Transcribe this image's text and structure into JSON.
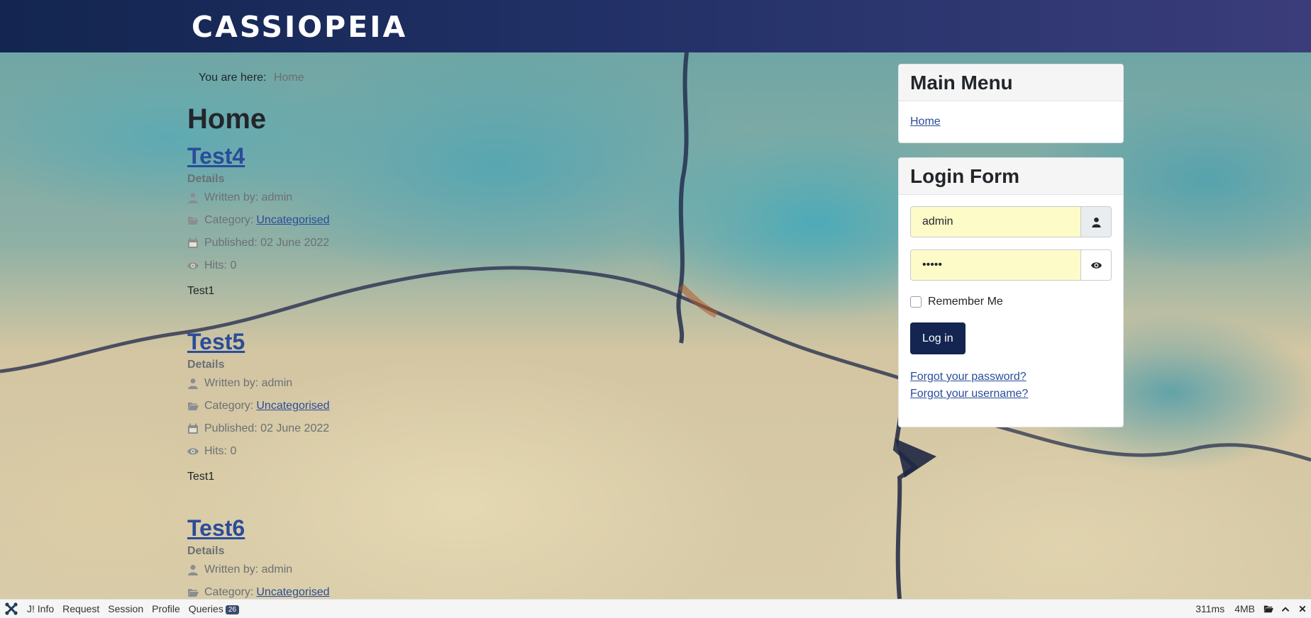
{
  "header": {
    "brand": "CASSIOPEIA",
    "gradient_start": "#132550",
    "gradient_end": "#3a3d7a"
  },
  "breadcrumb": {
    "prefix": "You are here:",
    "current": "Home"
  },
  "main": {
    "page_title": "Home",
    "articles": [
      {
        "title": "Test4",
        "details_label": "Details",
        "author": "Written by: admin",
        "category_prefix": "Category:",
        "category": "Uncategorised",
        "published": "Published: 02 June 2022",
        "hits": "Hits: 0",
        "body": "Test1"
      },
      {
        "title": "Test5",
        "details_label": "Details",
        "author": "Written by: admin",
        "category_prefix": "Category:",
        "category": "Uncategorised",
        "published": "Published: 02 June 2022",
        "hits": "Hits: 0",
        "body": "Test1"
      },
      {
        "title": "Test6",
        "details_label": "Details",
        "author": "Written by: admin",
        "category_prefix": "Category:",
        "category": "Uncategorised"
      }
    ]
  },
  "main_menu": {
    "title": "Main Menu",
    "items": [
      "Home"
    ]
  },
  "login_form": {
    "title": "Login Form",
    "username_value": "admin",
    "password_value": "•••••",
    "remember_label": "Remember Me",
    "login_button": "Log in",
    "forgot_password": "Forgot your password?",
    "forgot_username": "Forgot your username?",
    "username_icon": "user-icon",
    "password_icon": "eye-icon",
    "field_color": "#fdfbc8",
    "button_color": "#132550"
  },
  "debugbar": {
    "tabs": [
      "J! Info",
      "Request",
      "Session",
      "Profile",
      "Queries"
    ],
    "queries_count": "26",
    "time": "311ms",
    "memory": "4MB",
    "icons": [
      "joomla-icon",
      "folder-open-icon",
      "chevron-up-icon",
      "close-icon"
    ]
  }
}
